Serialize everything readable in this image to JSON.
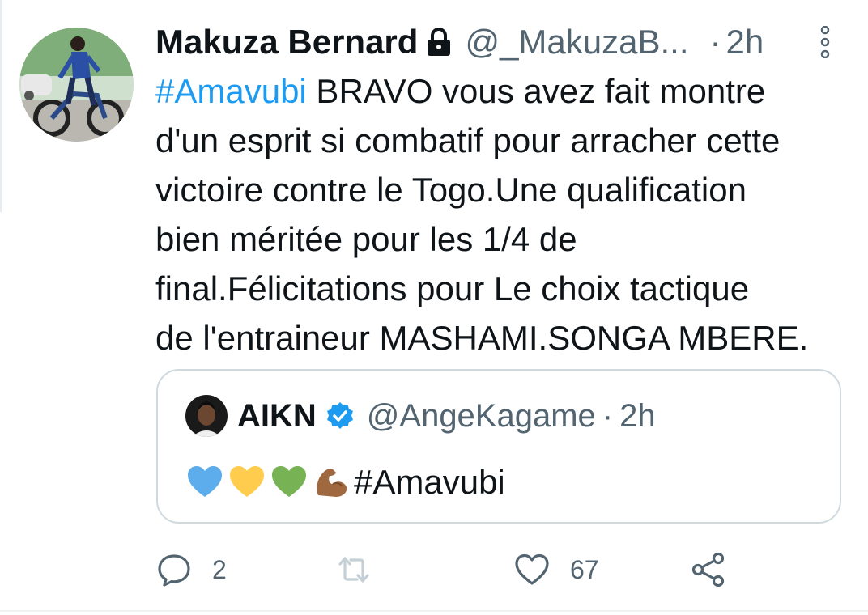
{
  "tweet": {
    "author": {
      "display_name": "Makuza Bernard",
      "handle": "@_MakuzaB...",
      "time": "2h",
      "separator": "·",
      "protected_icon": "lock-icon"
    },
    "text_lines": {
      "line1_hashtag": "#Amavubi",
      "line1_rest": " BRAVO vous avez fait montre",
      "line2": "d'un esprit si combatif pour arracher cette",
      "line3": "victoire contre le Togo.Une qualification",
      "line4": "bien méritée pour les 1/4 de",
      "line5": "final.Félicitations pour Le choix tactique",
      "line6": "de l'entraineur MASHAMI.SONGA MBERE."
    },
    "quote": {
      "display_name": "AIKN",
      "handle": "@AngeKagame",
      "separator": "·",
      "time": "2h",
      "verified_icon": "verified-badge-icon",
      "emojis": [
        "blue-heart-icon",
        "yellow-heart-icon",
        "green-heart-icon",
        "flexed-biceps-icon"
      ],
      "hashtag": "#Amavubi"
    },
    "actions": {
      "reply_count": "2",
      "retweet_count": "",
      "like_count": "67"
    }
  },
  "colors": {
    "link": "#1d9bf0",
    "secondary_text": "#536471",
    "primary_text": "#0f1419",
    "border": "#cfd9de"
  }
}
